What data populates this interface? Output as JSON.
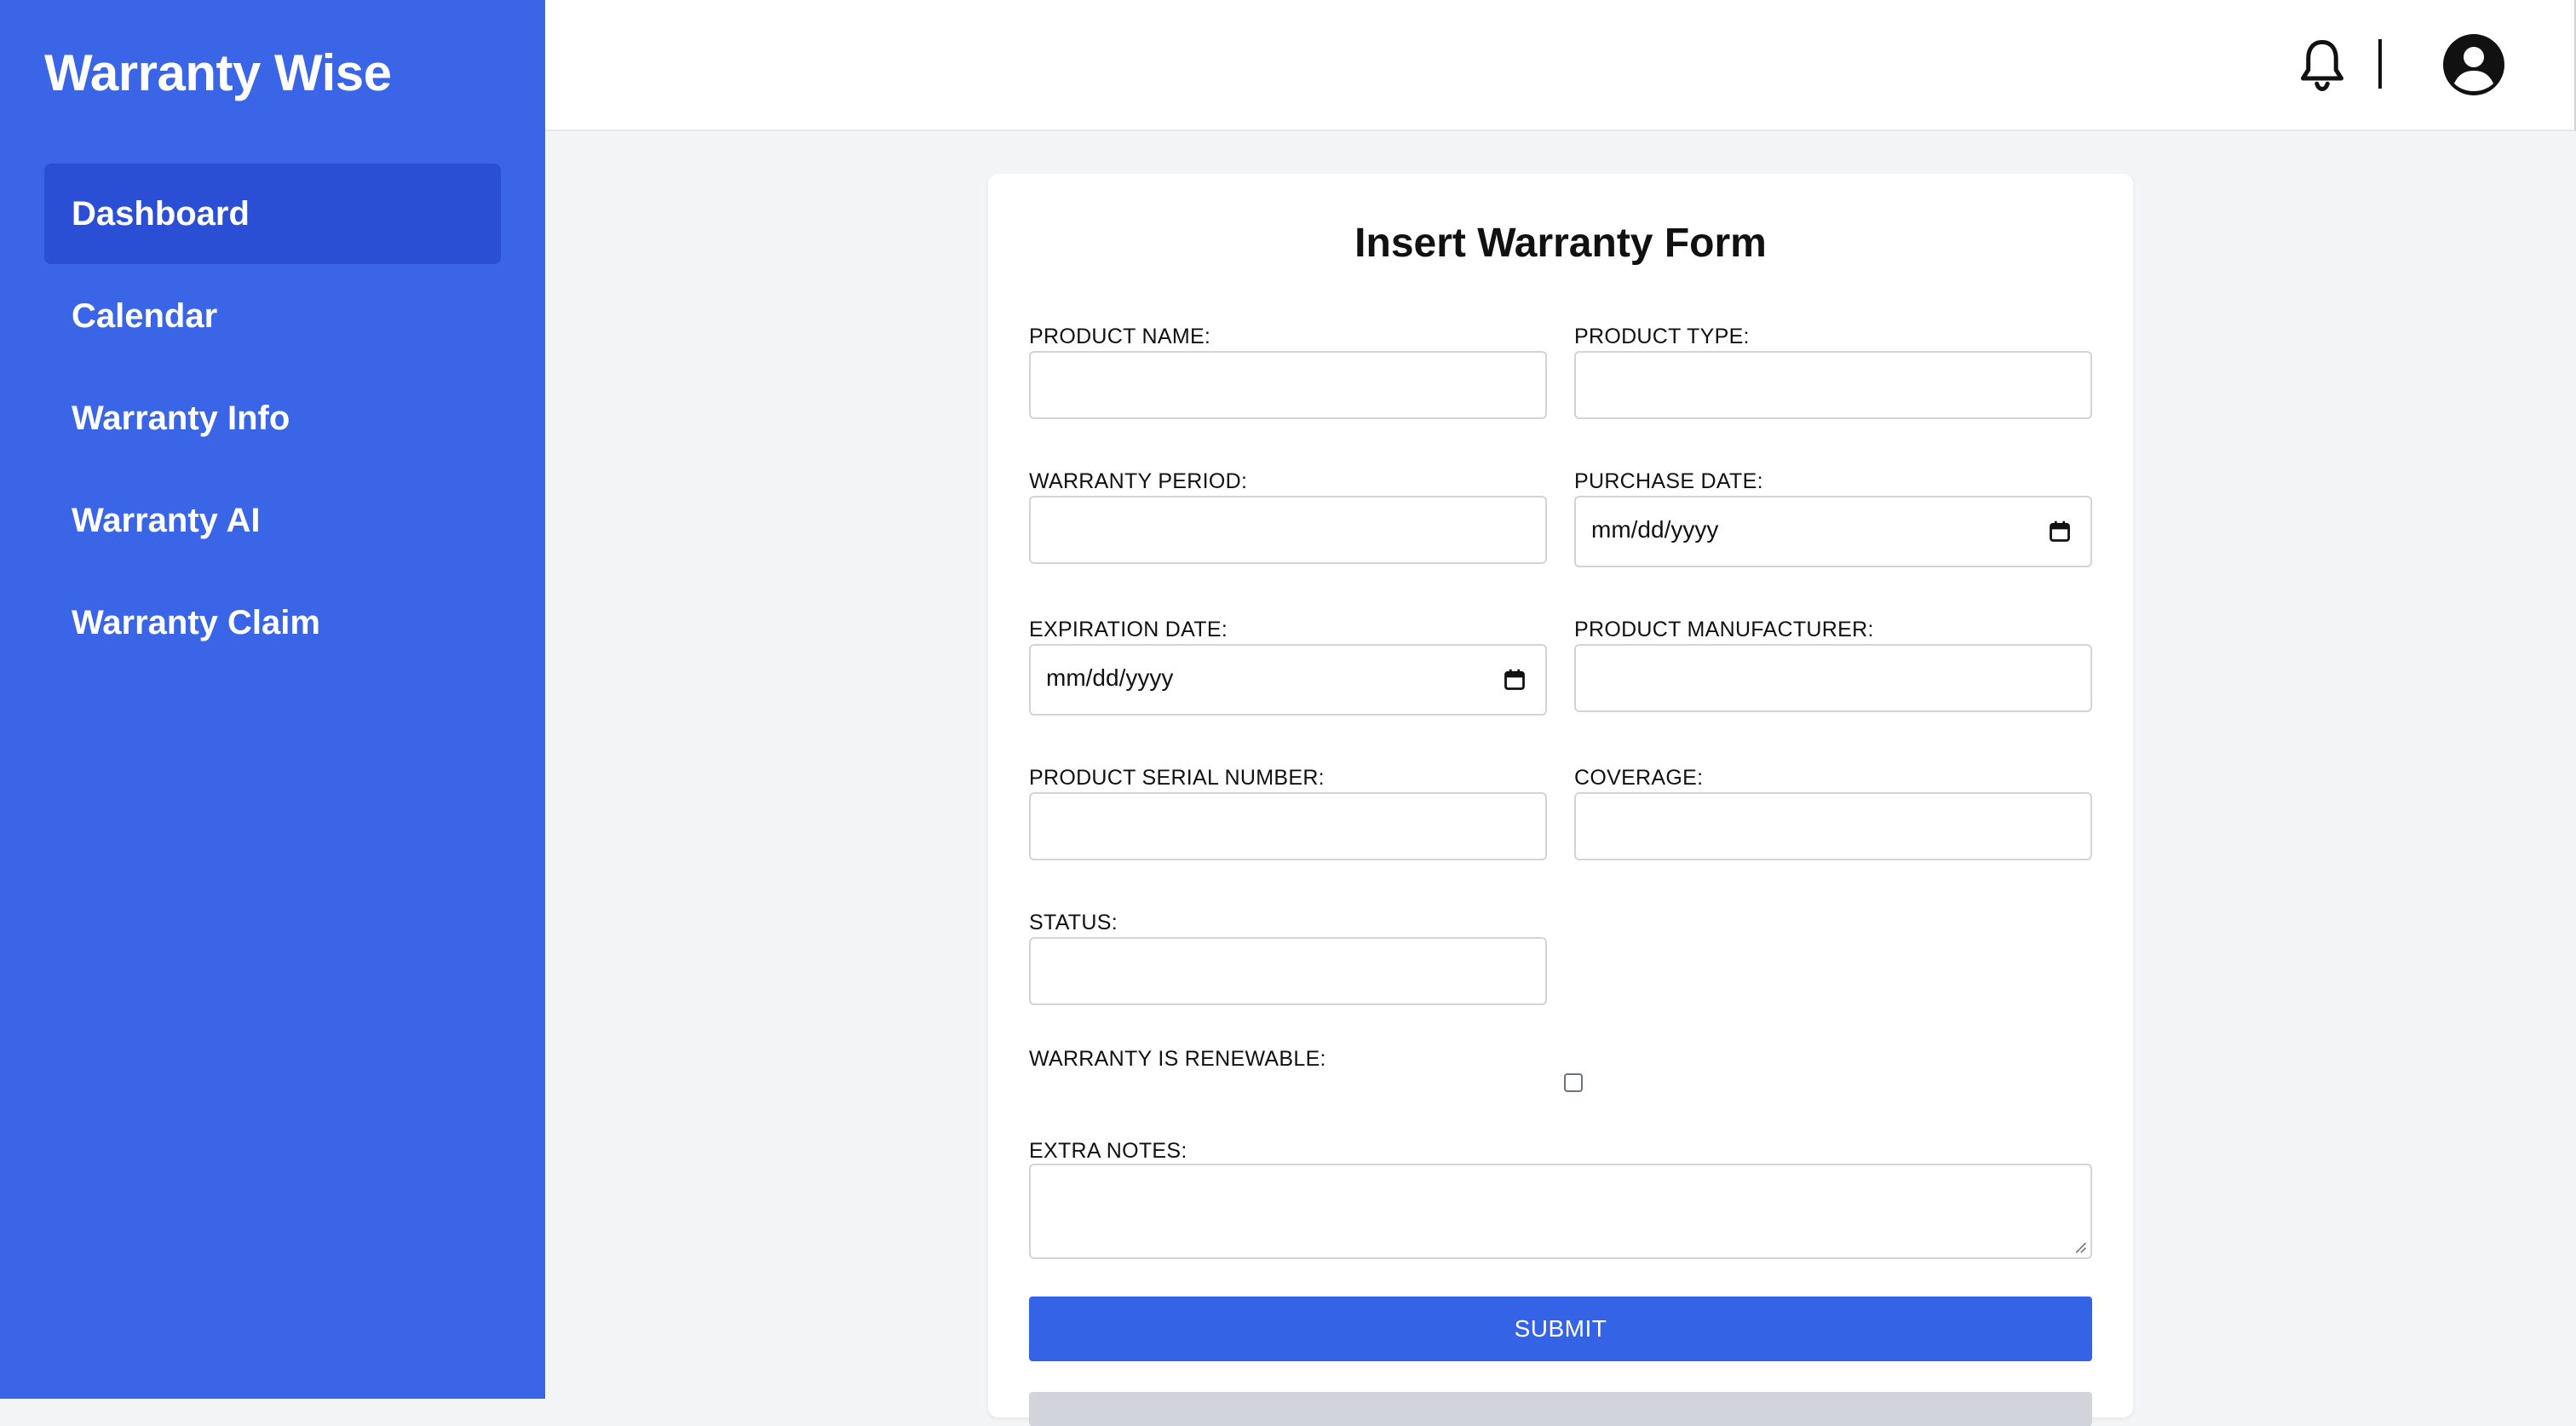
{
  "app": {
    "title": "Warranty Wise"
  },
  "sidebar": {
    "items": [
      {
        "label": "Dashboard",
        "active": true
      },
      {
        "label": "Calendar"
      },
      {
        "label": "Warranty Info"
      },
      {
        "label": "Warranty AI"
      },
      {
        "label": "Warranty Claim"
      }
    ]
  },
  "header": {
    "icons": [
      "bell-icon",
      "user-avatar-icon"
    ]
  },
  "form": {
    "title": "Insert Warranty Form",
    "fields": {
      "product_name": {
        "label": "PRODUCT NAME:",
        "value": ""
      },
      "product_type": {
        "label": "PRODUCT TYPE:",
        "value": ""
      },
      "warranty_period": {
        "label": "WARRANTY PERIOD:",
        "value": ""
      },
      "purchase_date": {
        "label": "PURCHASE DATE:",
        "placeholder": "mm/dd/yyyy"
      },
      "expiration_date": {
        "label": "EXPIRATION DATE:",
        "placeholder": "mm/dd/yyyy"
      },
      "product_manufacturer": {
        "label": "PRODUCT MANUFACTURER:",
        "value": ""
      },
      "product_serial_number": {
        "label": "PRODUCT SERIAL NUMBER:",
        "value": ""
      },
      "coverage": {
        "label": "COVERAGE:",
        "value": ""
      },
      "status": {
        "label": "STATUS:",
        "value": ""
      },
      "renewable": {
        "label": "WARRANTY IS RENEWABLE:",
        "checked": false
      },
      "extra_notes": {
        "label": "EXTRA NOTES:",
        "value": ""
      }
    },
    "submit_label": "SUBMIT"
  },
  "colors": {
    "sidebar_bg": "#3965e6",
    "sidebar_active": "#2a4fd5",
    "submit_bg": "#3563e6",
    "page_bg": "#f3f4f6"
  }
}
